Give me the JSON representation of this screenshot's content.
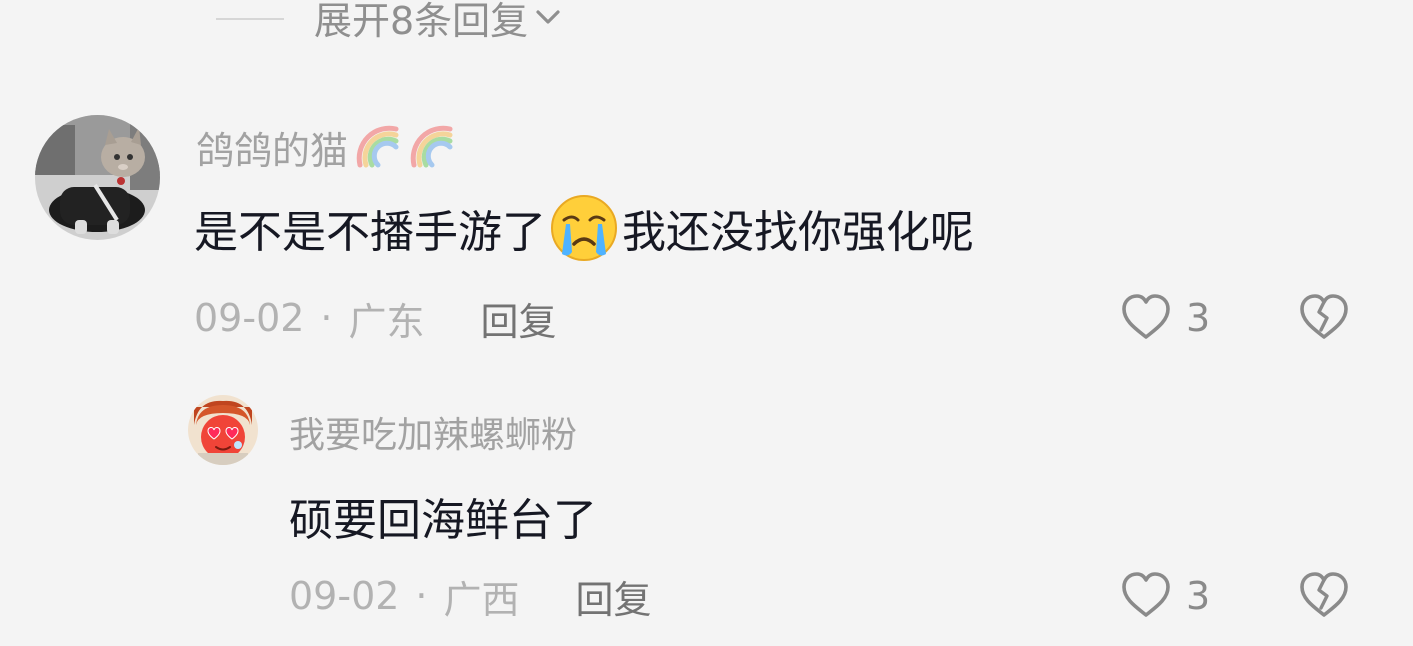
{
  "thread": {
    "expand_label": "展开8条回复",
    "expand_icon": "chevron-down-icon"
  },
  "comment": {
    "username": "鸽鸽的猫",
    "badges": [
      "rainbow-icon",
      "rainbow-icon"
    ],
    "text_before_emoji": "是不是不播手游了",
    "emoji": "crying-face-emoji",
    "text_after_emoji": "我还没找你强化呢",
    "date": "09-02",
    "separator": "·",
    "location": "广东",
    "reply_label": "回复",
    "like_count": "3"
  },
  "reply": {
    "username": "我要吃加辣螺蛳粉",
    "text": "硕要回海鲜台了",
    "date": "09-02",
    "separator": "·",
    "location": "广西",
    "reply_label": "回复",
    "like_count": "3"
  },
  "colors": {
    "background": "#f4f4f4",
    "comment_text": "#161823",
    "username": "#a2a2a2",
    "meta": "#b2b2b2",
    "icon": "#8a8a8a"
  }
}
